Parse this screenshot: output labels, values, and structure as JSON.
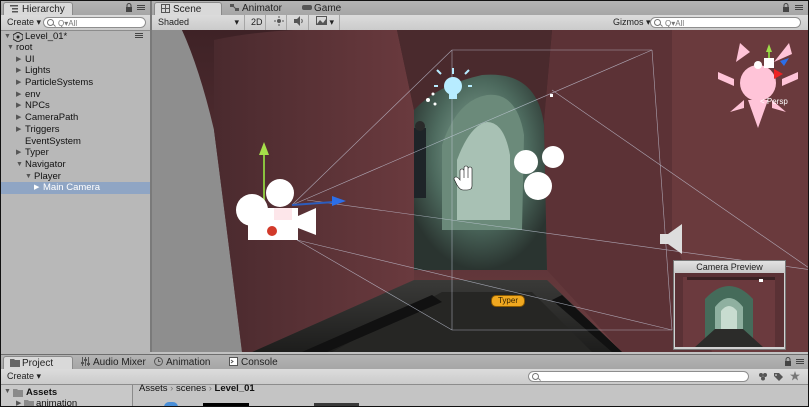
{
  "hierarchy": {
    "tab_label": "Hierarchy",
    "create_label": "Create",
    "search_placeholder": "Q▾All",
    "scene_name": "Level_01*",
    "items": [
      {
        "label": "root",
        "depth": 0,
        "arrow": "down"
      },
      {
        "label": "UI",
        "depth": 1,
        "arrow": "right"
      },
      {
        "label": "Lights",
        "depth": 1,
        "arrow": "right"
      },
      {
        "label": "ParticleSystems",
        "depth": 1,
        "arrow": "right"
      },
      {
        "label": "env",
        "depth": 1,
        "arrow": "right"
      },
      {
        "label": "NPCs",
        "depth": 1,
        "arrow": "right"
      },
      {
        "label": "CameraPath",
        "depth": 1,
        "arrow": "right"
      },
      {
        "label": "Triggers",
        "depth": 1,
        "arrow": "right"
      },
      {
        "label": "EventSystem",
        "depth": 1,
        "arrow": "none"
      },
      {
        "label": "Typer",
        "depth": 1,
        "arrow": "right"
      },
      {
        "label": "Navigator",
        "depth": 1,
        "arrow": "down"
      },
      {
        "label": "Player",
        "depth": 2,
        "arrow": "down"
      },
      {
        "label": "Main Camera",
        "depth": 3,
        "arrow": "right",
        "selected": true
      }
    ]
  },
  "scene_tabs": {
    "scene": "Scene",
    "animator": "Animator",
    "game": "Game"
  },
  "scene_toolbar": {
    "shading": "Shaded",
    "mode_2d": "2D",
    "gizmos": "Gizmos",
    "search_placeholder": "Q▾All"
  },
  "viewport": {
    "typer_label": "Typer",
    "persp_label": "< Persp",
    "camera_preview_title": "Camera Preview"
  },
  "bottom_tabs": {
    "project": "Project",
    "audio_mixer": "Audio Mixer",
    "animation": "Animation",
    "console": "Console"
  },
  "project": {
    "create_label": "Create",
    "tree": [
      {
        "label": "Assets",
        "bold": true
      },
      {
        "label": "animation",
        "bold": false
      }
    ],
    "breadcrumb": [
      "Assets",
      "scenes",
      "Level_01"
    ]
  }
}
